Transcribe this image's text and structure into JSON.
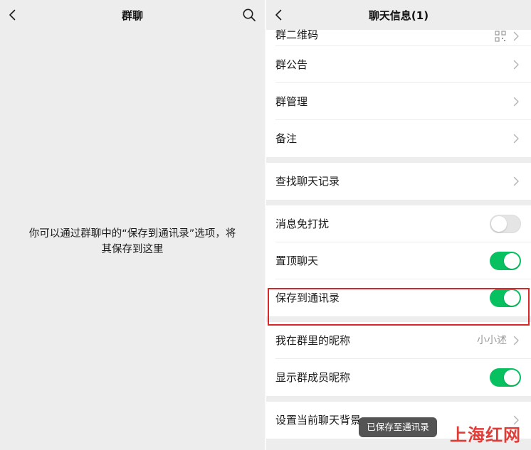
{
  "left": {
    "title": "群聊",
    "back_icon": "chevron-left-icon",
    "search_icon": "search-icon",
    "empty_message_line1": "你可以通过群聊中的“保存到通讯录”选项，将",
    "empty_message_line2": "其保存到这里"
  },
  "right": {
    "title": "聊天信息(1)",
    "back_icon": "chevron-left-icon",
    "rows": {
      "qr_code": "群二维码",
      "announcement": "群公告",
      "manage": "群管理",
      "remark": "备注",
      "search_history": "查找聊天记录",
      "mute": "消息免打扰",
      "pin": "置顶聊天",
      "save_contacts": "保存到通讯录",
      "my_nickname": "我在群里的昵称",
      "my_nickname_value": "小小述",
      "show_nicknames": "显示群成员昵称",
      "background": "设置当前聊天背景"
    },
    "toggles": {
      "mute": false,
      "pin": true,
      "save_contacts": true,
      "show_nicknames": true
    },
    "accent_color": "#07c160",
    "highlight_color": "#d9262b"
  },
  "toast": "已保存至通讯录",
  "watermark": "上海红网"
}
